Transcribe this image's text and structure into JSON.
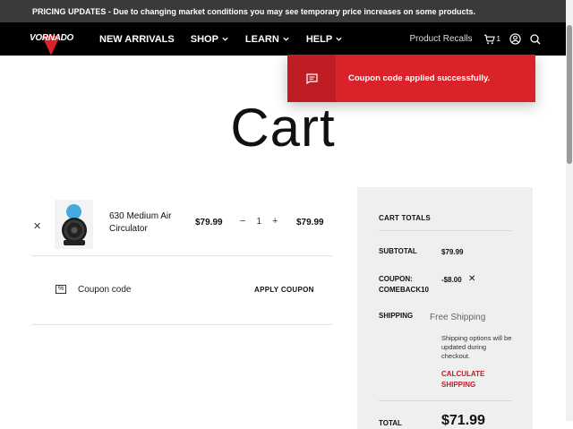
{
  "announcement": "PRICING UPDATES - Due to changing market conditions you may see temporary price increases on some products.",
  "brand": "VORNADO",
  "nav": {
    "items": [
      {
        "label": "NEW ARRIVALS"
      },
      {
        "label": "SHOP"
      },
      {
        "label": "LEARN"
      },
      {
        "label": "HELP"
      }
    ],
    "product_recalls": "Product Recalls",
    "cart_count": "1"
  },
  "toast": {
    "message": "Coupon code applied successfully."
  },
  "page_title": "Cart",
  "line_item": {
    "name": "630 Medium Air Circulator",
    "price": "$79.99",
    "quantity": "1",
    "line_total": "$79.99"
  },
  "coupon": {
    "label": "Coupon code",
    "apply_label": "APPLY COUPON"
  },
  "totals": {
    "heading": "CART TOTALS",
    "subtotal_label": "SUBTOTAL",
    "subtotal_value": "$79.99",
    "coupon_label": "COUPON: COMEBACK10",
    "coupon_value": "-$8.00",
    "shipping_label": "SHIPPING",
    "shipping_value": "Free Shipping",
    "shipping_note": "Shipping options will be updated during checkout.",
    "calculate_label": "CALCULATE SHIPPING",
    "total_label": "TOTAL",
    "total_value": "$71.99"
  },
  "colors": {
    "accent": "#d9222a",
    "announce_bg": "#3a3a3a",
    "nav_bg": "#000000",
    "totals_bg": "#efefef"
  }
}
